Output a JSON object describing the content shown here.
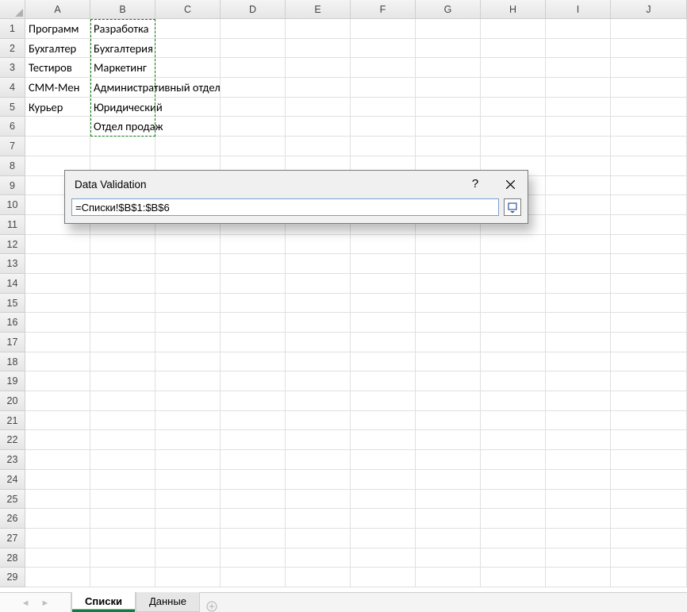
{
  "columns": [
    "A",
    "B",
    "C",
    "D",
    "E",
    "F",
    "G",
    "H",
    "I",
    "J"
  ],
  "rows": [
    1,
    2,
    3,
    4,
    5,
    6,
    7,
    8,
    9,
    10,
    11,
    12,
    13,
    14,
    15,
    16,
    17,
    18,
    19,
    20,
    21,
    22,
    23,
    24,
    25,
    26,
    27,
    28,
    29
  ],
  "cellsA": [
    "Программист",
    "Бухгалтер",
    "Тестировщик",
    "СММ-Менеджер",
    "Курьер"
  ],
  "cellsA_vis": [
    "Программ",
    "Бухгалтер",
    "Тестиров",
    "СММ-Мен",
    "Курьер"
  ],
  "cellsB": [
    "Разработка",
    "Бухгалтерия",
    "Маркетинг",
    "Административный отдел",
    "Юридический",
    "Отдел продаж"
  ],
  "dialog": {
    "title": "Data Validation",
    "formula": "=Списки!$B$1:$B$6",
    "help": "?"
  },
  "tabs": [
    {
      "label": "Списки",
      "active": true
    },
    {
      "label": "Данные",
      "active": false
    }
  ],
  "icons": {
    "add": "⊕"
  }
}
